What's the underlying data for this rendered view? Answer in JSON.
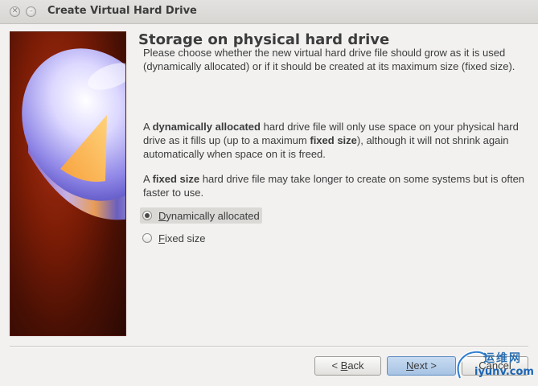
{
  "window": {
    "title": "Create Virtual Hard Drive",
    "close_glyph": "✕",
    "minimize_glyph": "–"
  },
  "page": {
    "heading": "Storage on physical hard drive",
    "para1": "Please choose whether the new virtual hard drive file should grow as it is used (dynamically allocated) or if it should be created at its maximum size (fixed size).",
    "para2": {
      "prefix": "A ",
      "bold1": "dynamically allocated",
      "mid": " hard drive file will only use space on your physical hard drive as it fills up (up to a maximum ",
      "bold2": "fixed size",
      "suffix": "), although it will not shrink again automatically when space on it is freed."
    },
    "para3": {
      "prefix": "A ",
      "bold1": "fixed size",
      "suffix": " hard drive file may take longer to create on some systems but is often faster to use."
    }
  },
  "options": [
    {
      "mnemonic": "D",
      "rest": "ynamically allocated",
      "selected": true
    },
    {
      "mnemonic": "F",
      "rest": "ixed size",
      "selected": false
    }
  ],
  "buttons": {
    "back": {
      "prefix": "< ",
      "mnemonic": "B",
      "rest": "ack"
    },
    "next": {
      "mnemonic": "N",
      "rest": "ext >"
    },
    "cancel": {
      "label": "Cancel"
    }
  },
  "watermark": {
    "cn": "运维网",
    "en": "iyunv.com"
  },
  "colors": {
    "accent": "#a7c3e4",
    "side_panel": "#7a1c06"
  }
}
